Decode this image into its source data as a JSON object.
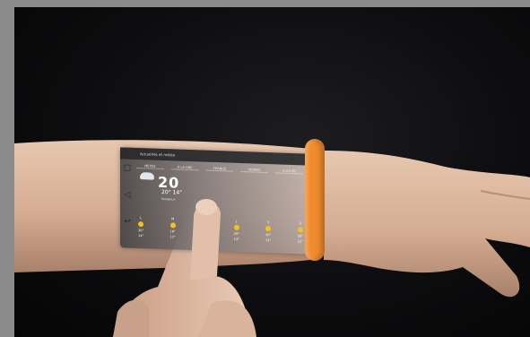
{
  "image": {
    "alt": "Arm with a projected smartphone weather interface and an orange wristband, finger touching the projected screen"
  },
  "projected_screen": {
    "title": "Actualités et météo",
    "tabs": [
      "MÉTÉO",
      "À LA UNE",
      "FRANCE",
      "MONDE",
      "CULTURE"
    ],
    "current_temp": "20",
    "hi_lo": "20° 14°",
    "city": "Nuageux",
    "days": [
      {
        "label": "L",
        "hi": "20°",
        "lo": "14°"
      },
      {
        "label": "M",
        "hi": "18°",
        "lo": "13°"
      },
      {
        "label": "M",
        "hi": "19°",
        "lo": "14°"
      },
      {
        "label": "J",
        "hi": "20°",
        "lo": "13°"
      },
      {
        "label": "V",
        "hi": "20°",
        "lo": "11°"
      },
      {
        "label": "S",
        "hi": "20°",
        "lo": "12°"
      }
    ]
  },
  "colors": {
    "wristband": "#f08b2e",
    "background": "#0d0d0f",
    "skin": "#d8b49a"
  }
}
